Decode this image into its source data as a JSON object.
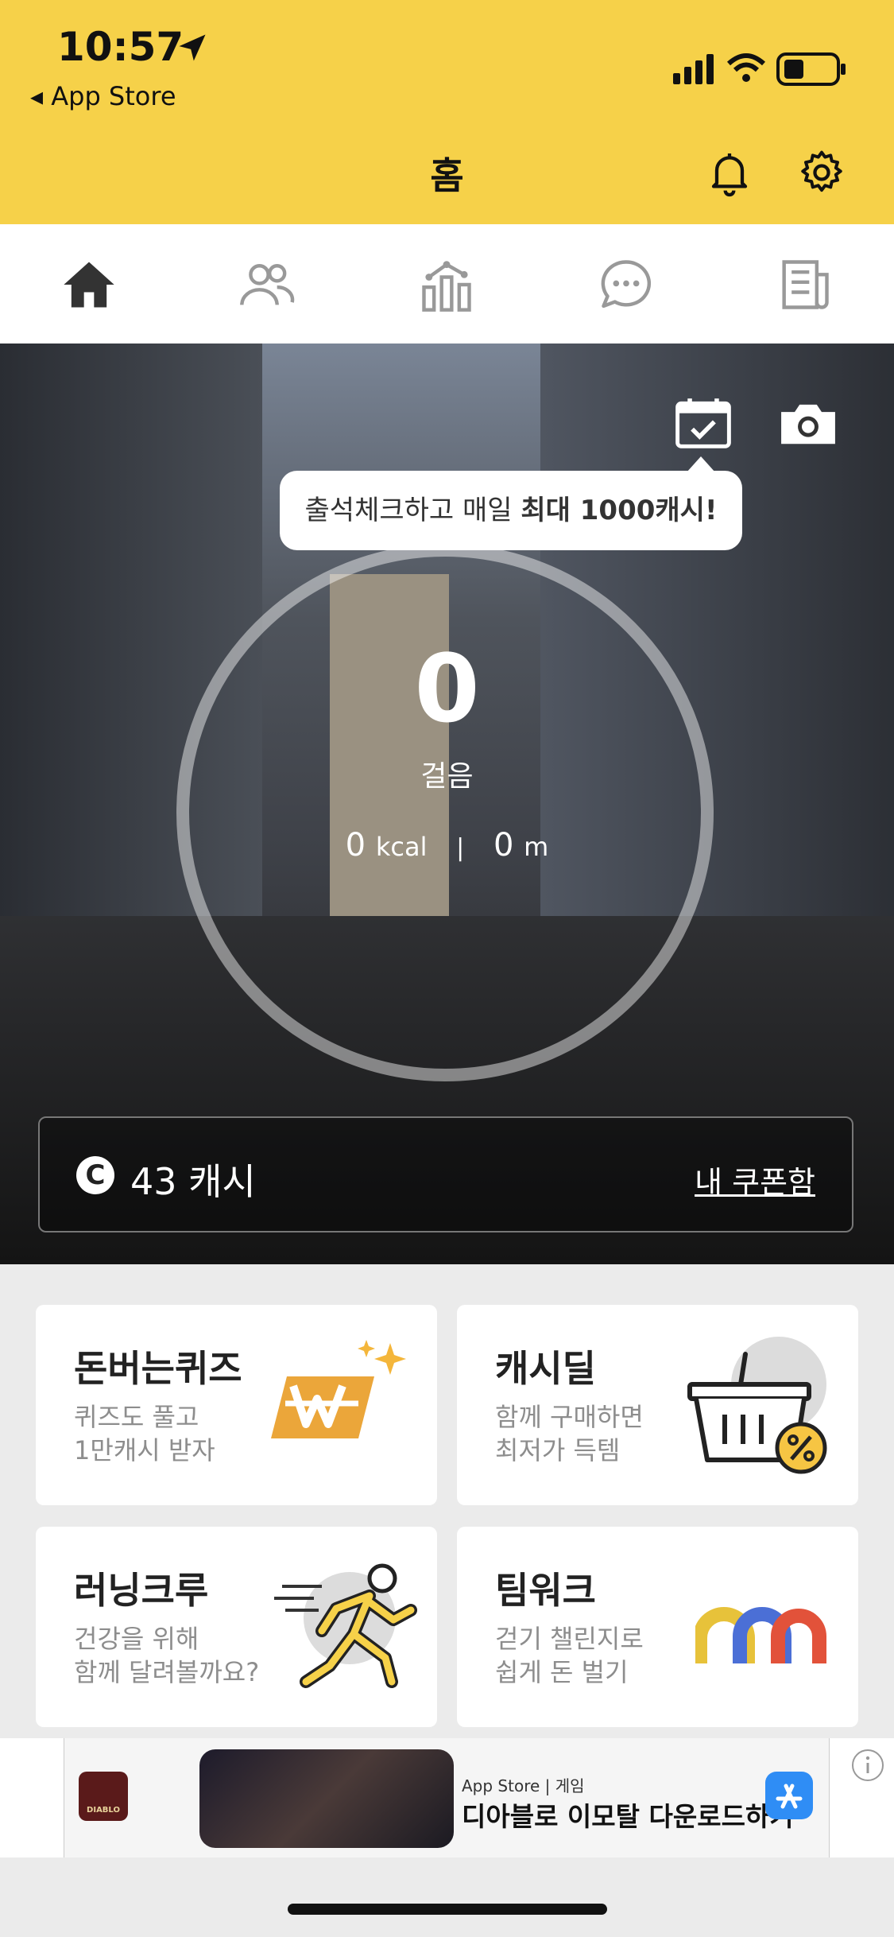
{
  "status_bar": {
    "time": "10:57",
    "back_label": "◂ App Store"
  },
  "header": {
    "title": "홈"
  },
  "tabs": [
    {
      "icon": "home-icon"
    },
    {
      "icon": "friends-icon"
    },
    {
      "icon": "stats-icon"
    },
    {
      "icon": "chat-icon"
    },
    {
      "icon": "news-icon"
    }
  ],
  "hero": {
    "tooltip_plain": "출석체크하고 매일 ",
    "tooltip_bold": "최대 1000캐시!",
    "steps": "0",
    "steps_label": "걸음",
    "kcal_value": "0",
    "kcal_unit": "kcal",
    "separator": "|",
    "distance_value": "0",
    "distance_unit": "m",
    "cash_symbol": "C",
    "cash": "43 캐시",
    "coupon_label": "내 쿠폰함"
  },
  "cards": [
    {
      "title": "돈버는퀴즈",
      "desc1": "퀴즈도 풀고",
      "desc2": "1만캐시 받자"
    },
    {
      "title": "캐시딜",
      "desc1": "함께 구매하면",
      "desc2": "최저가 득템"
    },
    {
      "title": "러닝크루",
      "desc1": "건강을 위해",
      "desc2": "함께 달려볼까요?"
    },
    {
      "title": "팀워크",
      "desc1": "걷기 챌린지로",
      "desc2": "쉽게 돈 벌기"
    }
  ],
  "ad": {
    "store_label": "App Store | 게임",
    "text": "디아블로 이모탈 다운로드하기",
    "logo_text": "DIABLO"
  },
  "colors": {
    "accent": "#f6d149",
    "orange": "#eba63a",
    "blue": "#4b6fd6",
    "red": "#e2523a"
  }
}
